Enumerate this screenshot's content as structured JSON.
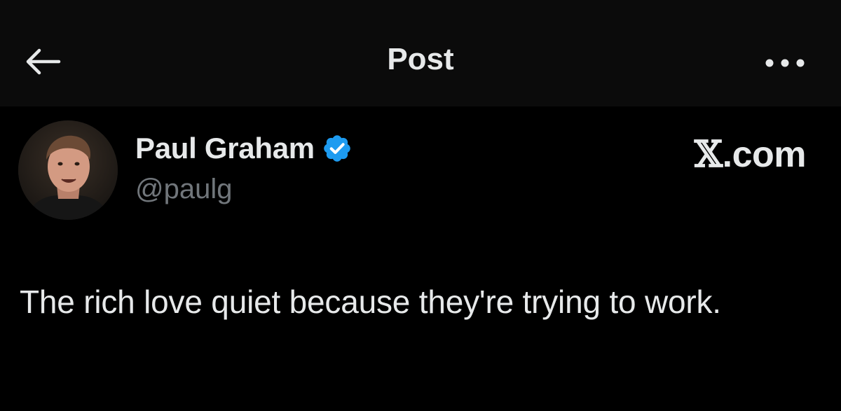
{
  "header": {
    "title": "Post",
    "back_icon": "arrow-left-icon",
    "more_icon": "ellipsis-icon"
  },
  "author": {
    "name": "Paul Graham",
    "handle": "@paulg",
    "verified": true,
    "verified_color": "#1d9bf0"
  },
  "brand": {
    "x_glyph": "𝕏",
    "suffix": ".com"
  },
  "post": {
    "text": "The rich love quiet because they're trying to work."
  },
  "colors": {
    "background": "#000000",
    "header_background": "#0b0b0b",
    "primary_text": "#e7e9ea",
    "secondary_text": "#71767b"
  }
}
